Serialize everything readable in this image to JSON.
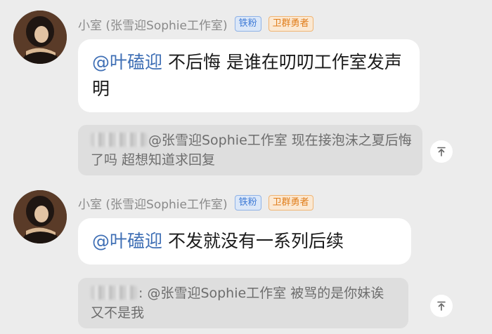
{
  "messages": [
    {
      "sender": "小室 (张雪迎Sophie工作室)",
      "badges": [
        "铁粉",
        "卫群勇者"
      ],
      "mention": "@叶磕迎",
      "text": " 不后悔 是谁在叨叨工作室发声明",
      "reply": {
        "mention": "@张雪迎Sophie工作室",
        "text": " 现在接泡沫之夏后悔了吗 超想知道求回复"
      }
    },
    {
      "sender": "小室 (张雪迎Sophie工作室)",
      "badges": [
        "铁粉",
        "卫群勇者"
      ],
      "mention": "@叶磕迎",
      "text": " 不发就没有一系列后续",
      "reply": {
        "mention": ": @张雪迎Sophie工作室",
        "text": " 被骂的是你妹诶 又不是我"
      }
    }
  ],
  "icons": {
    "avatar": "avatar-photo",
    "jump": "jump-to-original-icon"
  }
}
